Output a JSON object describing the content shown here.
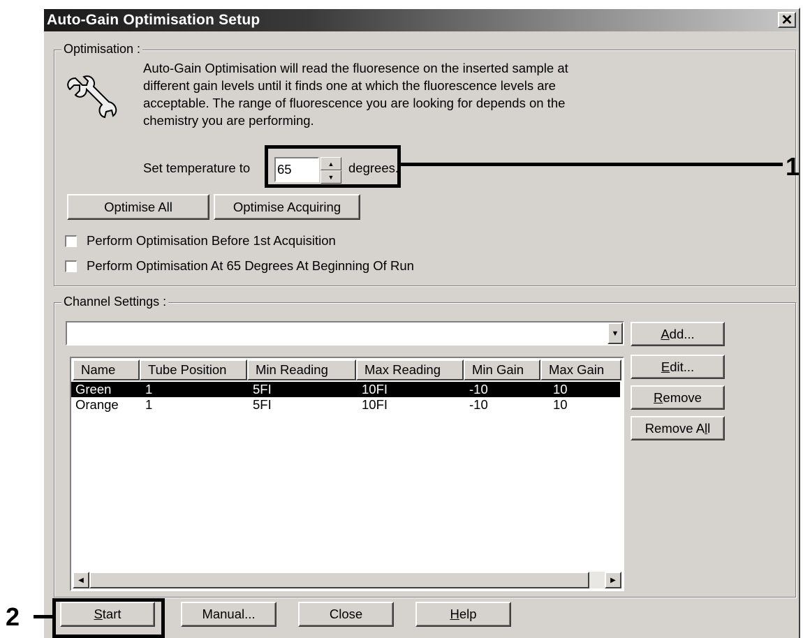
{
  "window": {
    "title": "Auto-Gain Optimisation Setup",
    "close_glyph": "✕"
  },
  "optimisation": {
    "group_label": "Optimisation :",
    "icon": "wrench-icon",
    "info_lines": [
      "Auto-Gain Optimisation will read the fluoresence on the inserted sample at",
      "different gain levels until it finds one at which the fluorescence levels are",
      "acceptable. The range of fluorescence you are looking for depends on the",
      "chemistry you are performing."
    ],
    "temp_label": "Set temperature to",
    "temp_value": "65",
    "temp_unit": "degrees.",
    "optimise_all": "Optimise All",
    "optimise_acquiring": "Optimise Acquiring",
    "checkbox1": {
      "label": "Perform Optimisation Before 1st Acquisition",
      "checked": false
    },
    "checkbox2": {
      "label": "Perform Optimisation At 65 Degrees At Beginning Of Run",
      "checked": false
    }
  },
  "channels": {
    "group_label": "Channel Settings :",
    "dropdown_value": "",
    "columns": [
      "Name",
      "Tube Position",
      "Min Reading",
      "Max Reading",
      "Min Gain",
      "Max Gain"
    ],
    "rows": [
      {
        "name": "Green",
        "tube": "1",
        "min_reading": "5FI",
        "max_reading": "10FI",
        "min_gain": "-10",
        "max_gain": "10",
        "selected": true
      },
      {
        "name": "Orange",
        "tube": "1",
        "min_reading": "5FI",
        "max_reading": "10FI",
        "min_gain": "-10",
        "max_gain": "10",
        "selected": false
      }
    ],
    "add": {
      "pre": "",
      "key": "A",
      "post": "dd..."
    },
    "edit": {
      "pre": "",
      "key": "E",
      "post": "dit..."
    },
    "remove": {
      "pre": "",
      "key": "R",
      "post": "emove"
    },
    "remove_all": {
      "pre": "Remove A",
      "key": "l",
      "post": "l"
    }
  },
  "footer": {
    "start": {
      "pre": "",
      "key": "S",
      "post": "tart"
    },
    "manual": "Manual...",
    "close": "Close",
    "help": {
      "pre": "",
      "key": "H",
      "post": "elp"
    }
  },
  "callouts": {
    "one": "1",
    "two": "2"
  }
}
